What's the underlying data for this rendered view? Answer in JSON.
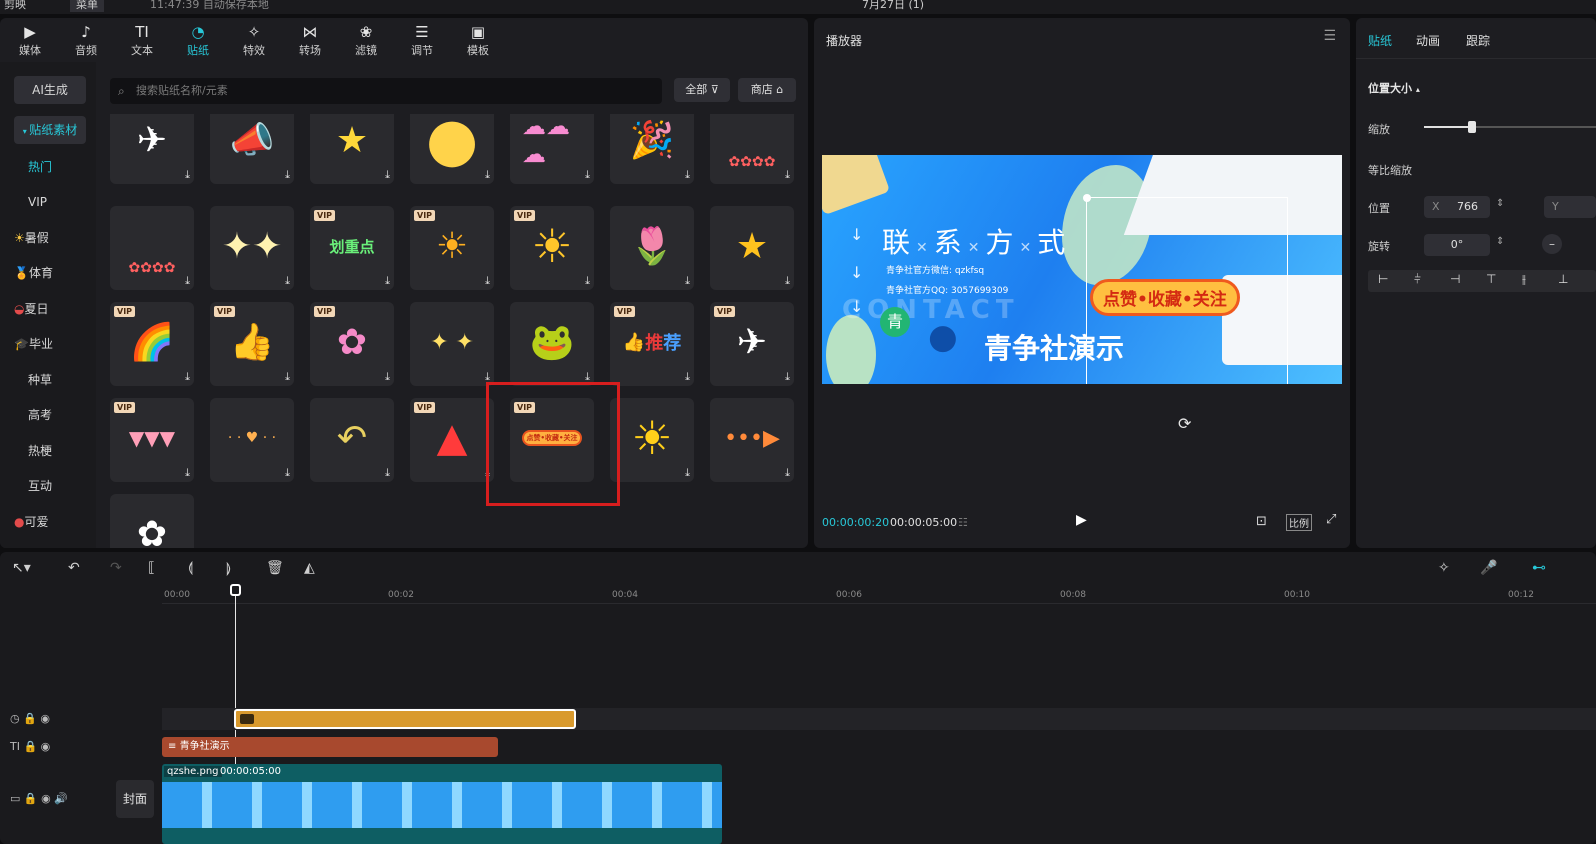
{
  "topbar": {
    "app_name": "剪映",
    "menu": "菜单",
    "autosave": "11:47:39 自动保存本地",
    "date_title": "7月27日 (1)"
  },
  "tabs": [
    {
      "label": "媒体",
      "icon": "media-icon"
    },
    {
      "label": "音频",
      "icon": "audio-icon"
    },
    {
      "label": "文本",
      "icon": "text-icon"
    },
    {
      "label": "贴纸",
      "icon": "sticker-icon"
    },
    {
      "label": "特效",
      "icon": "effects-icon"
    },
    {
      "label": "转场",
      "icon": "transition-icon"
    },
    {
      "label": "滤镜",
      "icon": "filter-icon"
    },
    {
      "label": "调节",
      "icon": "adjust-icon"
    },
    {
      "label": "模板",
      "icon": "template-icon"
    }
  ],
  "sidebar": {
    "ai_button": "AI生成",
    "category": "贴纸素材",
    "items": [
      "热门",
      "VIP",
      "暑假",
      "体育",
      "夏日",
      "毕业",
      "种草",
      "高考",
      "热梗",
      "互动",
      "可爱"
    ]
  },
  "search": {
    "placeholder": "搜索贴纸名称/元素",
    "filter_label": "全部",
    "store_label": "商店"
  },
  "sticker_grid": {
    "vip_badge": "VIP",
    "highlighted_sticker_text": "点赞•收藏•关注",
    "stamp_text": "划重点",
    "recommend_chars": [
      "推",
      "荐"
    ]
  },
  "player": {
    "title": "播放器",
    "current_time": "00:00:00:20",
    "total_time": "00:00:05:00",
    "ratio_button": "比例",
    "preview": {
      "heading_chars": [
        "联",
        "系",
        "方",
        "式"
      ],
      "wechat_line": "青争社官方微信: qzkfsq",
      "qq_line": "青争社官方QQ: 3057699309",
      "sticker_text": "点赞•收藏•关注",
      "brand_text": "青争社演示",
      "watermark": "CONTACT",
      "logo_char": "青"
    }
  },
  "right_panel": {
    "tabs": [
      "贴纸",
      "动画",
      "跟踪"
    ],
    "section_title": "位置大小",
    "scale_label": "缩放",
    "scale_value": 0.28,
    "uniform_scale_label": "等比缩放",
    "position_label": "位置",
    "pos_x_label": "X",
    "pos_x_value": "766",
    "pos_y_label": "Y",
    "rotation_label": "旋转",
    "rotation_value": "0°"
  },
  "timeline": {
    "ruler_ticks": [
      "00:00",
      "00:02",
      "00:04",
      "00:06",
      "00:08",
      "00:10",
      "00:12"
    ],
    "text_clip_label": "青争社演示",
    "video_clip_name": "qzshe.png",
    "video_clip_duration": "00:00:05:00",
    "cover_label": "封面"
  }
}
